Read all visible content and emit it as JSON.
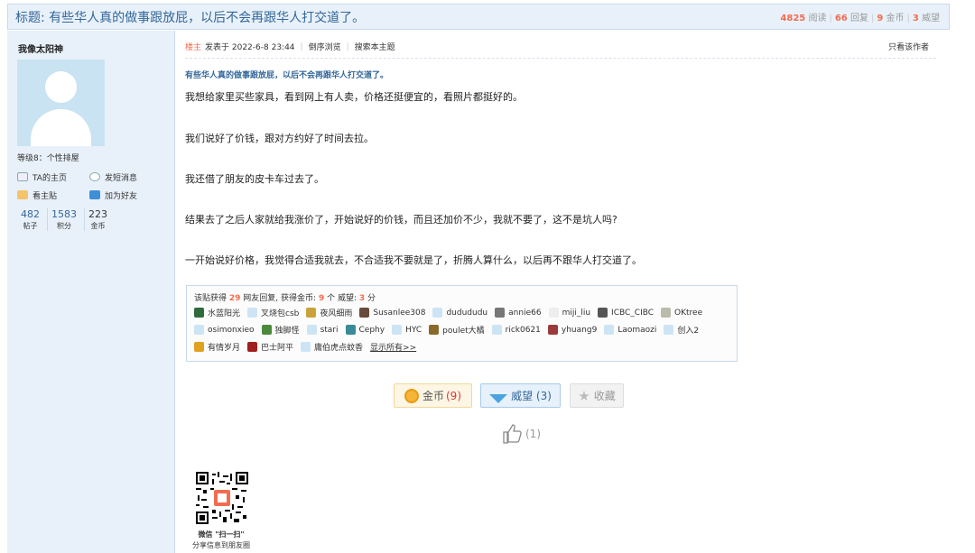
{
  "header": {
    "title": "标题: 有些华人真的做事跟放屁，以后不会再跟华人打交道了。",
    "stats": {
      "views": "4825",
      "views_label": "阅读",
      "replies": "66",
      "replies_label": "回复",
      "gold": "9",
      "gold_label": "金币",
      "weiwang": "3",
      "weiwang_label": "威望"
    }
  },
  "author": {
    "name": "我像太阳神",
    "level": "等级8：个性排屋",
    "links": [
      {
        "label": "TA的主页",
        "icon": "home-icon"
      },
      {
        "label": "发短消息",
        "icon": "message-icon"
      },
      {
        "label": "看主贴",
        "icon": "post-icon"
      },
      {
        "label": "加为好友",
        "icon": "add-friend-icon"
      }
    ],
    "stats": [
      {
        "value": "482",
        "label": "帖子"
      },
      {
        "value": "1583",
        "label": "积分"
      },
      {
        "value": "223",
        "label": "金币"
      }
    ]
  },
  "post": {
    "floor": "楼主",
    "posted": "发表于 2022-6-8 23:44",
    "reverse_browse": "倒序浏览",
    "search_topic": "搜索本主题",
    "only_author": "只看该作者",
    "subject": "有些华人真的做事跟放屁，以后不会再跟华人打交道了。",
    "paragraphs": [
      "我想给家里买些家具，看到网上有人卖，价格还挺便宜的，看照片都挺好的。",
      "我们说好了价钱，跟对方约好了时间去拉。",
      "我还借了朋友的皮卡车过去了。",
      "结果去了之后人家就给我涨价了，开始说好的价钱，而且还加价不少，我就不要了，这不是坑人吗?",
      "一开始说好价格，我觉得合适我就去，不合适我不要就是了，折腾人算什么，以后再不跟华人打交道了。"
    ]
  },
  "rewards": {
    "summary_prefix": "该贴获得",
    "replies": "29",
    "summary_mid": "网友回复, 获得金币:",
    "gold": "9",
    "summary_mid2": "个 威望:",
    "weiwang": "3",
    "summary_suffix": "分",
    "rows": [
      [
        "水蓝阳光",
        "叉烧包csb",
        "夜风细雨",
        "Susanlee308",
        "dudududu",
        "annie66",
        "miji_liu",
        "ICBC_CIBC",
        "OKtree"
      ],
      [
        "osimonxieo",
        "独脚怪",
        "stari",
        "Cephy",
        "HYC",
        "poulet大橘",
        "rick0621",
        "yhuang9",
        "Laomaozi",
        "创入2"
      ],
      [
        "有情岁月",
        "巴士阿平",
        "庸伯虎点蚊香"
      ]
    ],
    "show_all": "显示所有>>"
  },
  "actions": {
    "gold_label": "金币",
    "gold_count": "(9)",
    "weiwang_label": "威望",
    "weiwang_count": "(3)",
    "fav_label": "收藏",
    "like_count": "(1)"
  },
  "share": {
    "line1": "微信 \"扫一扫\"",
    "line2": "分享信息到朋友圈"
  },
  "colors": {
    "accent": "#336699",
    "highlight": "#f26c4f",
    "sidebar_bg": "#e8f1fa"
  }
}
